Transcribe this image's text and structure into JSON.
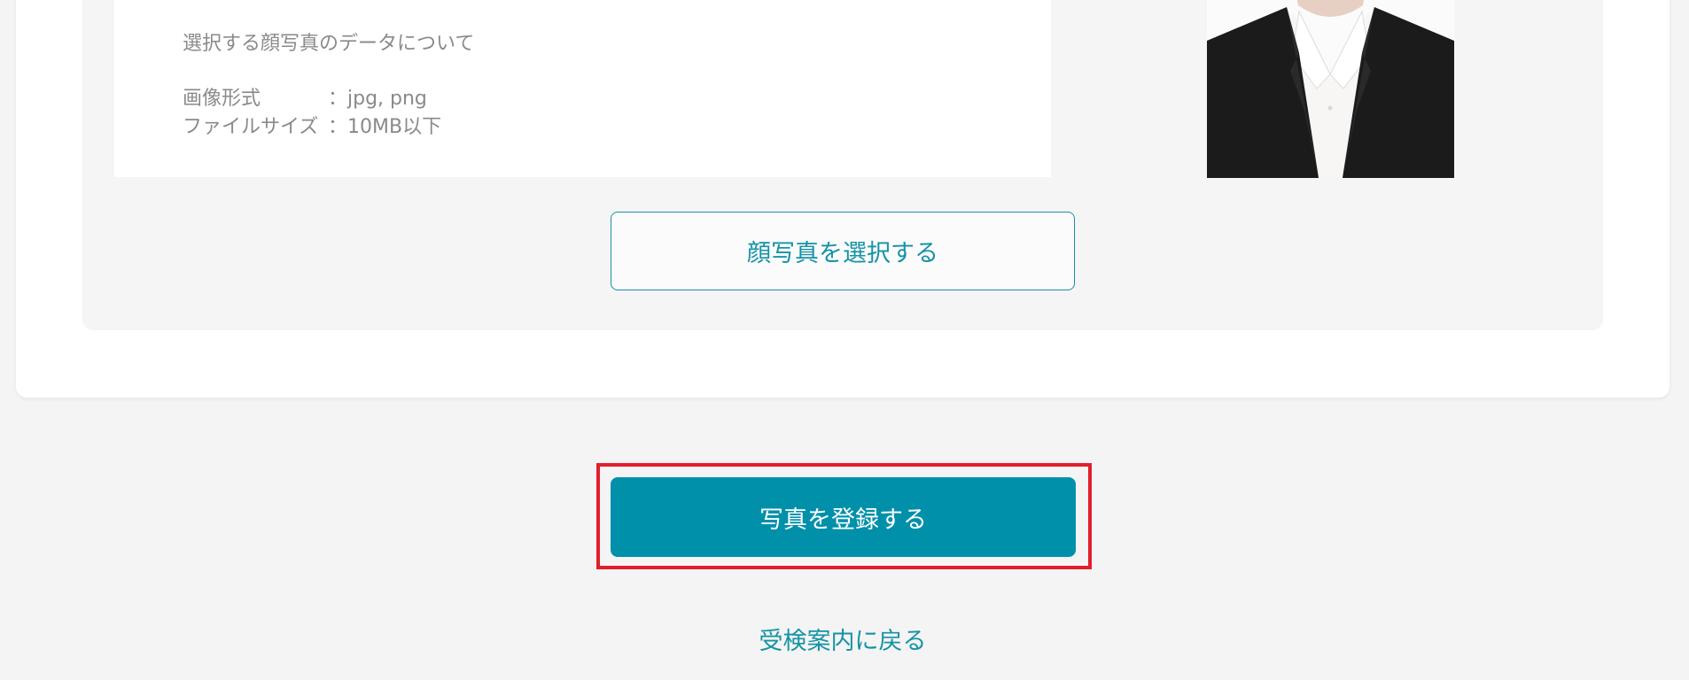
{
  "info": {
    "heading": "選択する顔写真のデータについて",
    "format_label": "画像形式",
    "format_value": "：jpg, png",
    "size_label": "ファイルサイズ",
    "size_value": "：10MB以下"
  },
  "buttons": {
    "select_photo": "顔写真を選択する",
    "register_photo": "写真を登録する"
  },
  "links": {
    "back": "受検案内に戻る"
  },
  "colors": {
    "accent": "#0090aa",
    "link": "#1593a6",
    "highlight": "#e0202b",
    "panel_bg": "#f5f5f5",
    "page_bg": "#f4f4f4"
  },
  "icons": {
    "photo": "portrait-photo"
  }
}
